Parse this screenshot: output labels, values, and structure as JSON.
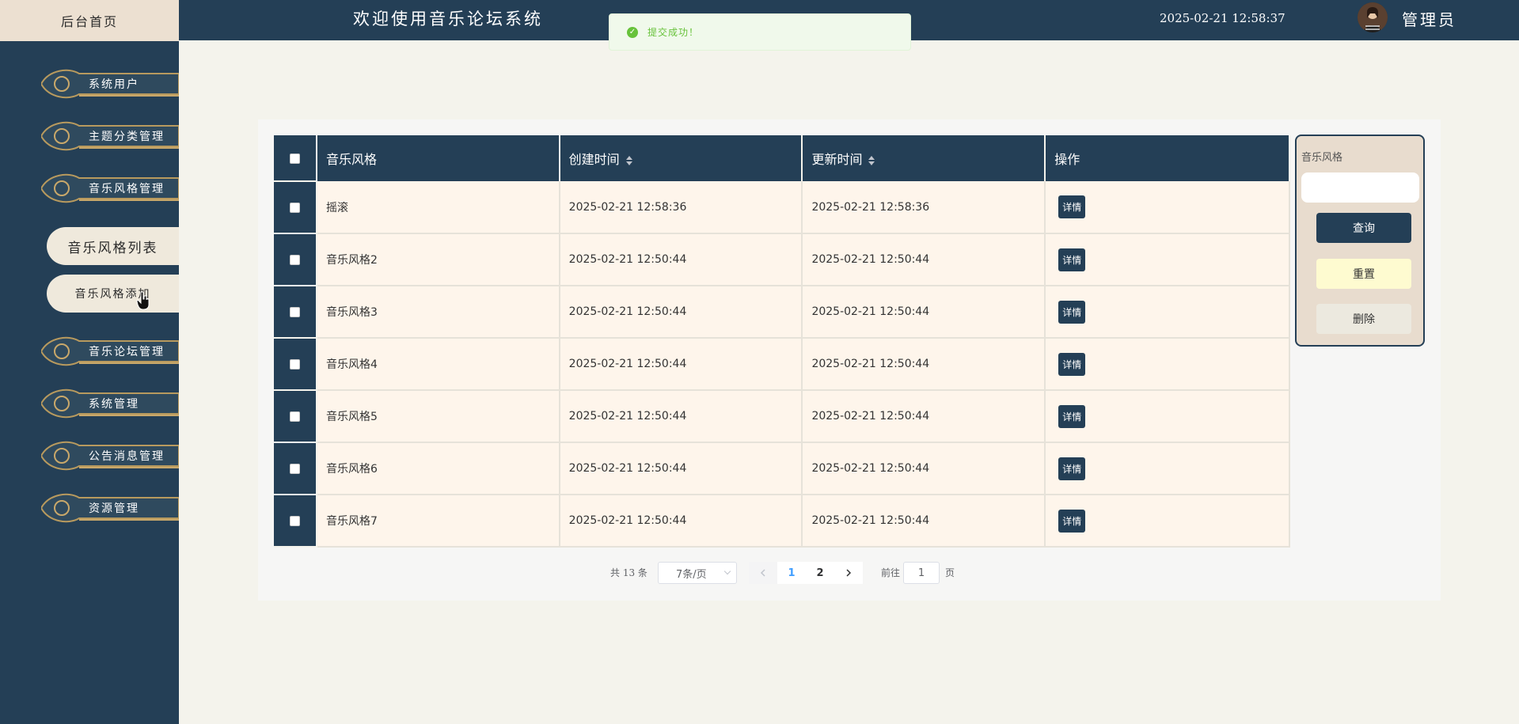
{
  "sidebar": {
    "home_tab": "后台首页",
    "items": [
      {
        "label": "系统用户"
      },
      {
        "label": "主题分类管理"
      },
      {
        "label": "音乐风格管理"
      },
      {
        "label": "音乐论坛管理"
      },
      {
        "label": "系统管理"
      },
      {
        "label": "公告消息管理"
      },
      {
        "label": "资源管理"
      }
    ],
    "sub_items": [
      {
        "label": "音乐风格列表",
        "active": true
      },
      {
        "label": "音乐风格添加",
        "active": false
      }
    ]
  },
  "header": {
    "title": "欢迎使用音乐论坛系统",
    "datetime": "2025-02-21 12:58:37",
    "user": "管理员"
  },
  "toast": {
    "message": "提交成功！",
    "icon": "check-circle-icon"
  },
  "table": {
    "columns": [
      "音乐风格",
      "创建时间",
      "更新时间",
      "操作"
    ],
    "rows": [
      {
        "style": "摇滚",
        "created": "2025-02-21 12:58:36",
        "updated": "2025-02-21 12:58:36",
        "action": "详情"
      },
      {
        "style": "音乐风格2",
        "created": "2025-02-21 12:50:44",
        "updated": "2025-02-21 12:50:44",
        "action": "详情"
      },
      {
        "style": "音乐风格3",
        "created": "2025-02-21 12:50:44",
        "updated": "2025-02-21 12:50:44",
        "action": "详情"
      },
      {
        "style": "音乐风格4",
        "created": "2025-02-21 12:50:44",
        "updated": "2025-02-21 12:50:44",
        "action": "详情"
      },
      {
        "style": "音乐风格5",
        "created": "2025-02-21 12:50:44",
        "updated": "2025-02-21 12:50:44",
        "action": "详情"
      },
      {
        "style": "音乐风格6",
        "created": "2025-02-21 12:50:44",
        "updated": "2025-02-21 12:50:44",
        "action": "详情"
      },
      {
        "style": "音乐风格7",
        "created": "2025-02-21 12:50:44",
        "updated": "2025-02-21 12:50:44",
        "action": "详情"
      }
    ]
  },
  "search": {
    "label": "音乐风格",
    "value": "",
    "query_label": "查询",
    "reset_label": "重置",
    "delete_label": "删除"
  },
  "pagination": {
    "total_text": "共 13 条",
    "page_size": "7条/页",
    "pages": [
      "1",
      "2"
    ],
    "current_page": "1",
    "goto_prefix": "前往",
    "goto_value": "1",
    "goto_suffix": "页"
  },
  "colors": {
    "navy": "#243f56",
    "cream": "#fef5eb",
    "success": "#67c23a",
    "active_page": "#409eff"
  }
}
